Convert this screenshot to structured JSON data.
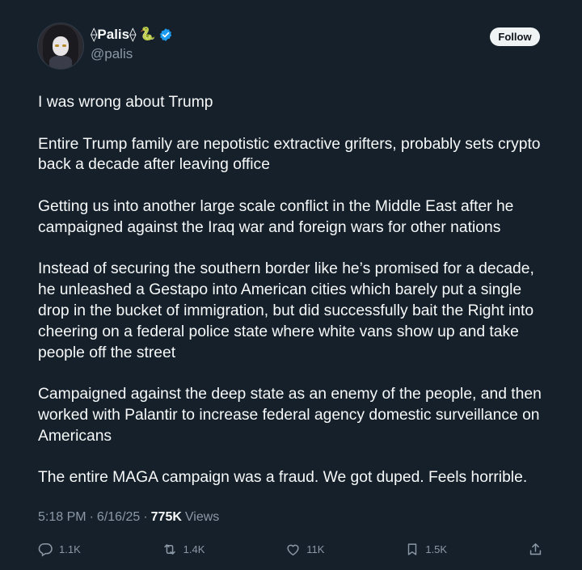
{
  "author": {
    "display_name": "⟠Palis⟠",
    "snake_emoji": "🐍",
    "handle": "@palis",
    "verified": true
  },
  "follow_label": "Follow",
  "tweet": {
    "paragraphs": [
      "I was wrong about Trump",
      "Entire Trump family are nepotistic extractive grifters, probably sets crypto back a decade after leaving office",
      "Getting us into another large scale conflict in the Middle East after he campaigned against the Iraq war and foreign wars for other nations",
      "Instead of securing the southern border like he’s promised for a decade, he unleashed a Gestapo into American cities which barely put a single drop in the bucket of immigration, but did successfully bait the Right into cheering on a federal police state where white vans show up and take people off the street",
      "Campaigned against the deep state as an enemy of the people, and then worked with Palantir to increase federal agency domestic surveillance on Americans",
      "The entire MAGA campaign was a fraud. We got duped. Feels horrible."
    ]
  },
  "meta": {
    "time": "5:18 PM",
    "sep1": "·",
    "date": "6/16/25",
    "sep2": "·",
    "views_count": "775K",
    "views_label": "Views"
  },
  "actions": {
    "replies": "1.1K",
    "reposts": "1.4K",
    "likes": "11K",
    "bookmarks": "1.5K"
  },
  "colors": {
    "background": "#15202b",
    "text": "#f7f9f9",
    "secondary": "#8b98a5",
    "verified_blue": "#1d9bf0"
  },
  "icons": [
    "reply-icon",
    "repost-icon",
    "like-icon",
    "bookmark-icon",
    "share-icon",
    "verified-badge-icon"
  ]
}
